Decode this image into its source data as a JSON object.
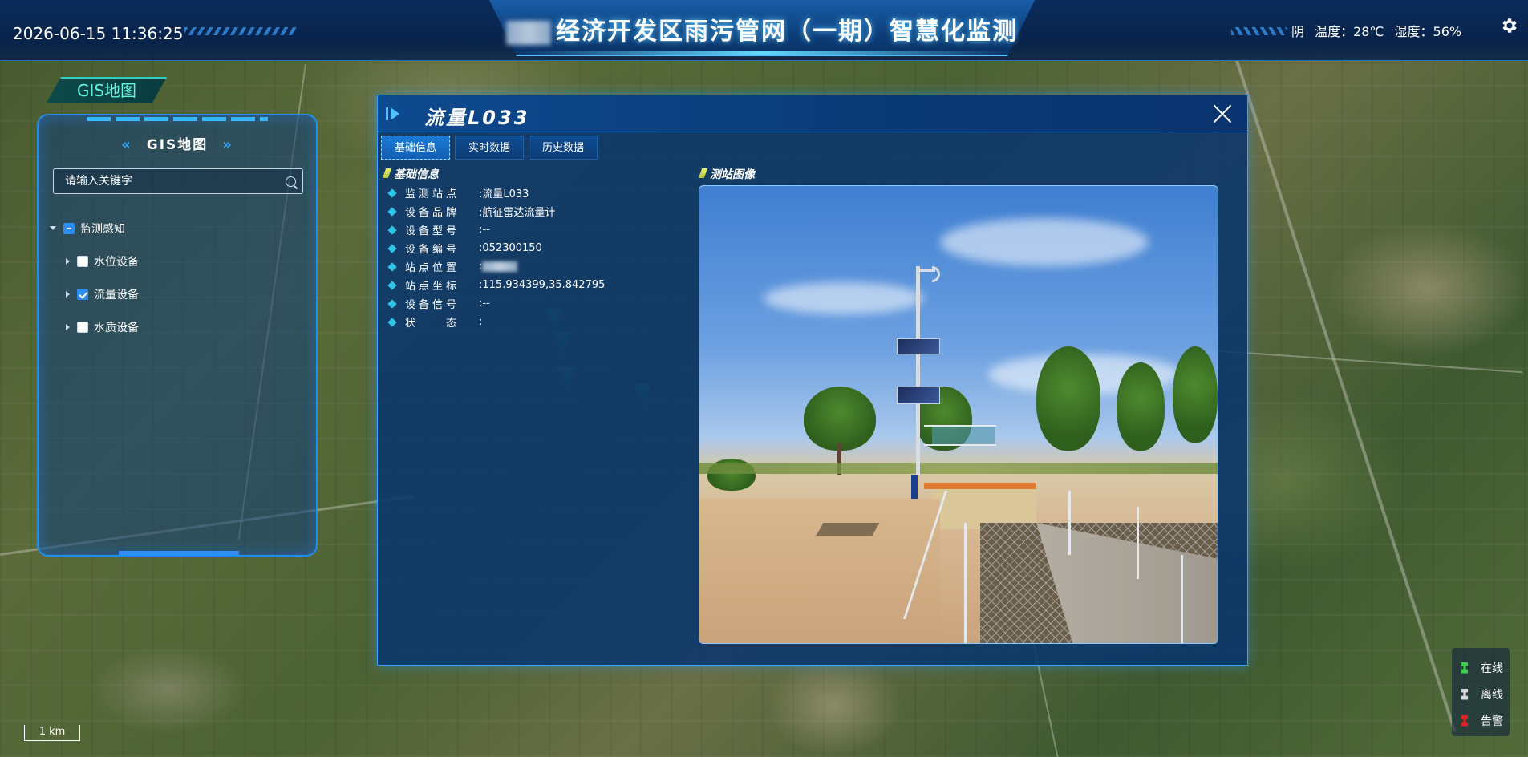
{
  "header": {
    "datetime": "2026-06-15 11:36:25",
    "title": "经济开发区雨污管网（一期）智慧化监测",
    "weather": {
      "condition": "阴",
      "temperature": "温度：28℃",
      "humidity": "湿度：56%"
    },
    "settings_icon": "gear-icon"
  },
  "left_panel": {
    "tab_label": "GIS地图",
    "title": "GIS地图",
    "search": {
      "placeholder": "请输入关键字",
      "value": ""
    },
    "tree": {
      "root": {
        "label": "监测感知",
        "state": "partial"
      },
      "children": [
        {
          "label": "水位设备",
          "checked": false
        },
        {
          "label": "流量设备",
          "checked": true
        },
        {
          "label": "水质设备",
          "checked": false
        }
      ]
    }
  },
  "dialog": {
    "title": "流量L033",
    "tabs": [
      {
        "label": "基础信息",
        "active": true
      },
      {
        "label": "实时数据",
        "active": false
      },
      {
        "label": "历史数据",
        "active": false
      }
    ],
    "info_section_label": "基础信息",
    "image_section_label": "测站图像",
    "info": [
      {
        "key": "监测站点",
        "value": ":流量L033"
      },
      {
        "key": "设备品牌",
        "value": ":航征雷达流量计"
      },
      {
        "key": "设备型号",
        "value": ":--"
      },
      {
        "key": "设备编号",
        "value": ":052300150"
      },
      {
        "key": "站点位置",
        "value": ":"
      },
      {
        "key": "站点坐标",
        "value": ":115.934399,35.842795"
      },
      {
        "key": "设备信号",
        "value": ":--"
      },
      {
        "key": "状　　态",
        "value": ":"
      }
    ]
  },
  "legend": {
    "items": [
      {
        "label": "在线",
        "color": "#3ad14a"
      },
      {
        "label": "离线",
        "color": "#d9d9d9"
      },
      {
        "label": "告警",
        "color": "#e02424"
      }
    ]
  },
  "scale": {
    "label": "1 km"
  },
  "colors": {
    "accent": "#3aa6ff",
    "panel_bg": "#08346e",
    "checkbox_checked": "#2d8cf0"
  }
}
